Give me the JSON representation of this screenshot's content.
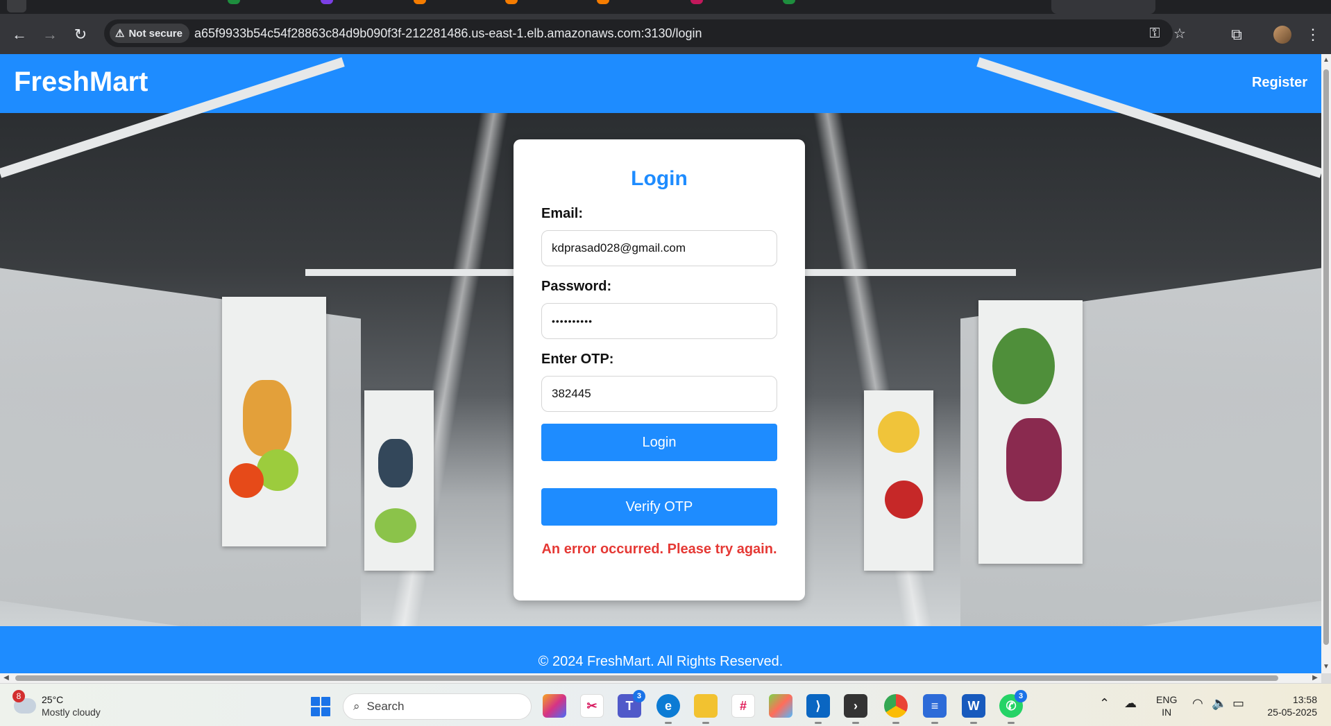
{
  "browser": {
    "security_label": "Not secure",
    "url": "a65f9933b54c54f28863c84d9b090f3f-212281486.us-east-1.elb.amazonaws.com:3130/login"
  },
  "site": {
    "brand": "FreshMart",
    "nav": {
      "register_label": "Register"
    },
    "footer": "© 2024 FreshMart. All Rights Reserved."
  },
  "login": {
    "title": "Login",
    "email_label": "Email:",
    "email_value": "kdprasad028@gmail.com",
    "password_label": "Password:",
    "password_value": "••••••••••",
    "otp_label": "Enter OTP:",
    "otp_value": "382445",
    "login_button": "Login",
    "verify_button": "Verify OTP",
    "error_message": "An error occurred. Please try again."
  },
  "taskbar": {
    "weather_badge": "8",
    "temperature": "25°C",
    "condition": "Mostly cloudy",
    "search_label": "Search",
    "teams_badge": "3",
    "whatsapp_badge": "3",
    "lang_top": "ENG",
    "lang_bottom": "IN",
    "time": "13:58",
    "date": "25-05-2025"
  },
  "colors": {
    "brand_blue": "#1e8cff",
    "error_red": "#e53935"
  }
}
